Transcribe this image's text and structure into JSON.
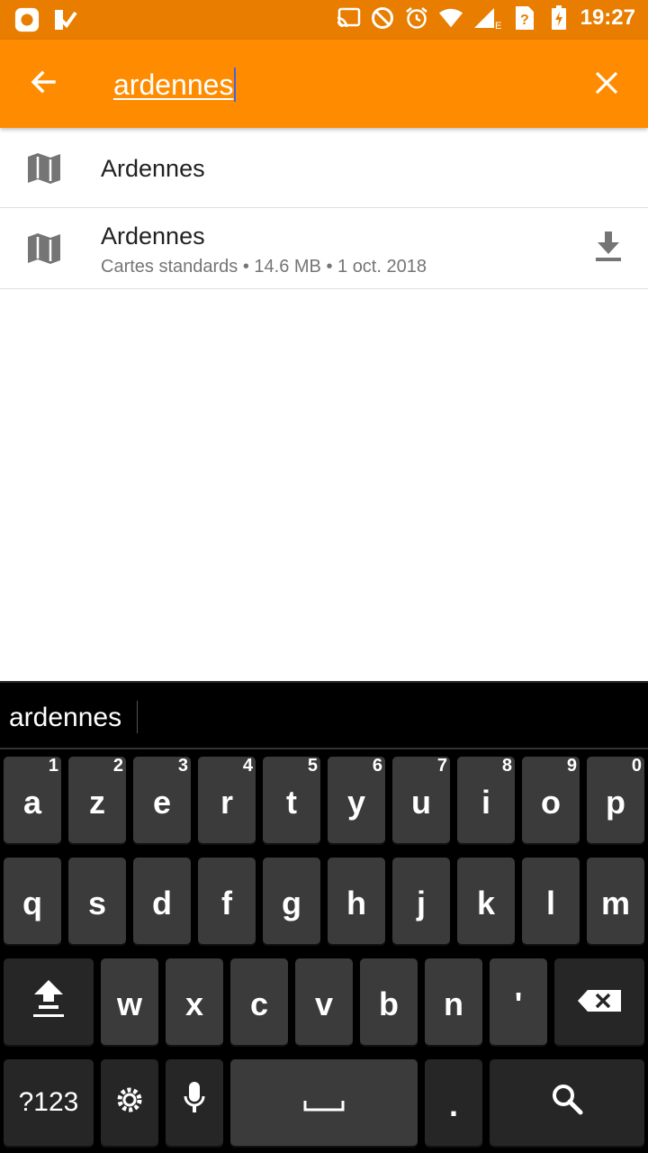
{
  "status_bar": {
    "time": "19:27",
    "left_icons": [
      "notification-app-icon",
      "notification-check-icon"
    ],
    "right_icons": [
      "cast-icon",
      "do-not-disturb-icon",
      "alarm-icon",
      "wifi-icon",
      "signal-icon",
      "network-e-icon",
      "sim-unknown-icon",
      "battery-charging-icon"
    ],
    "network_type": "E"
  },
  "toolbar": {
    "search_value": "ardennes",
    "back_icon": "arrow-back-icon",
    "clear_icon": "close-icon",
    "color": "#ff8c00"
  },
  "results": [
    {
      "title": "Ardennes",
      "subtitle": "",
      "icon": "map-icon"
    },
    {
      "title": "Ardennes",
      "subtitle": "Cartes standards • 14.6 MB • 1 oct. 2018",
      "icon": "map-icon",
      "action_icon": "download-icon"
    }
  ],
  "keyboard": {
    "suggestion": "ardennes",
    "row1": [
      {
        "label": "a",
        "hint": "1"
      },
      {
        "label": "z",
        "hint": "2"
      },
      {
        "label": "e",
        "hint": "3"
      },
      {
        "label": "r",
        "hint": "4"
      },
      {
        "label": "t",
        "hint": "5"
      },
      {
        "label": "y",
        "hint": "6"
      },
      {
        "label": "u",
        "hint": "7"
      },
      {
        "label": "i",
        "hint": "8"
      },
      {
        "label": "o",
        "hint": "9"
      },
      {
        "label": "p",
        "hint": "0"
      }
    ],
    "row2": [
      "q",
      "s",
      "d",
      "f",
      "g",
      "h",
      "j",
      "k",
      "l",
      "m"
    ],
    "row3": [
      "w",
      "x",
      "c",
      "v",
      "b",
      "n",
      "'"
    ],
    "symbols_label": "?123",
    "period_label": "."
  }
}
